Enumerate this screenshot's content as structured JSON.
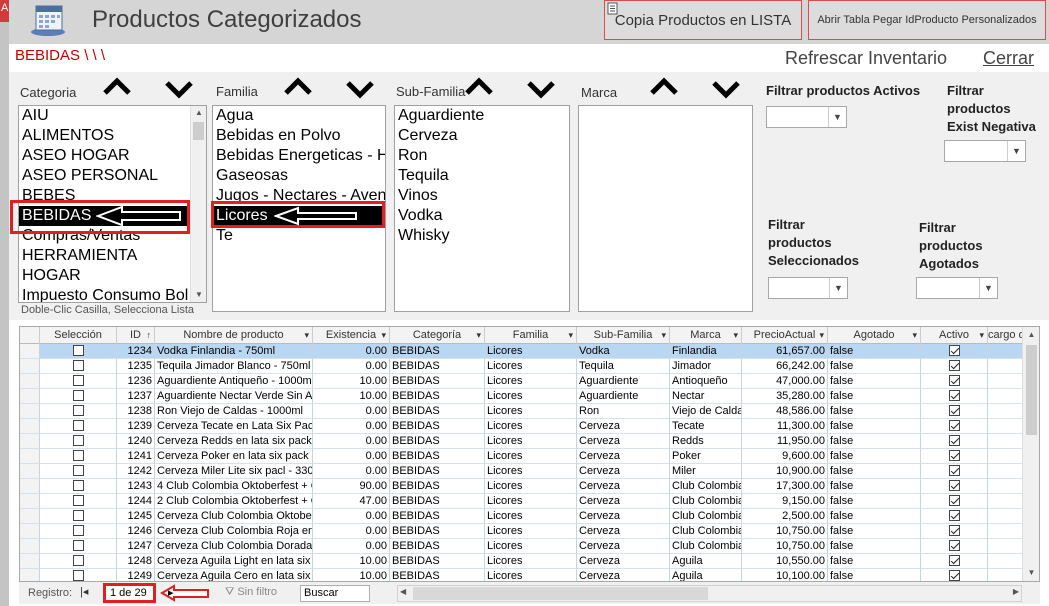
{
  "window": {
    "title": "Productos Categorizados",
    "edge_letter": "A"
  },
  "toolbar": {
    "copy_list_label": "Copia Productos en LISTA",
    "open_table_label": "Abrir Tabla Pegar IdProducto Personalizados",
    "refresh_label": "Refrescar Inventario",
    "close_label": "Cerrar"
  },
  "breadcrumb": "BEBIDAS \\ \\ \\",
  "filters": {
    "categoria": {
      "label": "Categoria",
      "items": [
        "AIU",
        "ALIMENTOS",
        "ASEO HOGAR",
        "ASEO PERSONAL",
        "BEBES",
        "BEBIDAS",
        "Compras/Ventas",
        "HERRAMIENTA",
        "HOGAR",
        "Impuesto Consumo Bol"
      ],
      "selected": "BEBIDAS"
    },
    "familia": {
      "label": "Familia",
      "items": [
        "Agua",
        "Bebidas en Polvo",
        "Bebidas Energeticas - Hi",
        "Gaseosas",
        "Jugos - Nectares - Aven",
        "Licores",
        "Te"
      ],
      "selected": "Licores"
    },
    "subfamilia": {
      "label": "Sub-Familia",
      "items": [
        "Aguardiente",
        "Cerveza",
        "Ron",
        "Tequila",
        "Vinos",
        "Vodka",
        "Whisky"
      ]
    },
    "marca": {
      "label": "Marca",
      "items": []
    },
    "hint": "Doble-Clic Casilla, Selecciona Lista"
  },
  "side_filters": {
    "activos": "Filtrar productos Activos",
    "exist_negativa": "Filtrar productos Exist Negativa",
    "seleccionados": "Filtrar productos Seleccionados",
    "agotados": "Filtrar productos Agotados"
  },
  "table": {
    "columns": [
      "Selección",
      "ID",
      "Nombre de producto",
      "Existencia",
      "Categoría",
      "Familia",
      "Sub-Familia",
      "Marca",
      "PrecioActual",
      "Agotado",
      "Activo",
      "cargo de"
    ],
    "rows": [
      [
        "1234",
        "Vodka Finlandia - 750ml",
        "0.00",
        "BEBIDAS",
        "Licores",
        "Vodka",
        "Finlandia",
        "61,657.00",
        "false"
      ],
      [
        "1235",
        "Tequila Jimador Blanco - 750ml",
        "0.00",
        "BEBIDAS",
        "Licores",
        "Tequila",
        "Jimador",
        "66,242.00",
        "false"
      ],
      [
        "1236",
        "Aguardiente Antiqueño - 1000ml",
        "10.00",
        "BEBIDAS",
        "Licores",
        "Aguardiente",
        "Antioqueño",
        "47,000.00",
        "false"
      ],
      [
        "1237",
        "Aguardiente Nectar Verde Sin Az",
        "10.00",
        "BEBIDAS",
        "Licores",
        "Aguardiente",
        "Nectar",
        "35,280.00",
        "false"
      ],
      [
        "1238",
        "Ron Viejo de Caldas - 1000ml",
        "0.00",
        "BEBIDAS",
        "Licores",
        "Ron",
        "Viejo de Calda",
        "48,586.00",
        "false"
      ],
      [
        "1239",
        "Cerveza Tecate en Lata Six Pack",
        "0.00",
        "BEBIDAS",
        "Licores",
        "Cerveza",
        "Tecate",
        "11,300.00",
        "false"
      ],
      [
        "1240",
        "Cerveza Redds en lata six pack -",
        "0.00",
        "BEBIDAS",
        "Licores",
        "Cerveza",
        "Redds",
        "11,950.00",
        "false"
      ],
      [
        "1241",
        "Cerveza Poker en lata six pack -",
        "0.00",
        "BEBIDAS",
        "Licores",
        "Cerveza",
        "Poker",
        "9,600.00",
        "false"
      ],
      [
        "1242",
        "Cerveza Miler Lite six pacl - 330m",
        "0.00",
        "BEBIDAS",
        "Licores",
        "Cerveza",
        "Miler",
        "10,900.00",
        "false"
      ],
      [
        "1243",
        "4 Club Colombia Oktoberfest + Ch",
        "90.00",
        "BEBIDAS",
        "Licores",
        "Cerveza",
        "Club Colombia",
        "17,300.00",
        "false"
      ],
      [
        "1244",
        "2 Club Colombia Oktoberfest + Ch",
        "47.00",
        "BEBIDAS",
        "Licores",
        "Cerveza",
        "Club Colombia",
        "9,150.00",
        "false"
      ],
      [
        "1245",
        "Cerveza Club Colombia Oktoberfe",
        "0.00",
        "BEBIDAS",
        "Licores",
        "Cerveza",
        "Club Colombia",
        "2,500.00",
        "false"
      ],
      [
        "1246",
        "Cerveza Club Colombia Roja en la",
        "0.00",
        "BEBIDAS",
        "Licores",
        "Cerveza",
        "Club Colombia",
        "10,750.00",
        "false"
      ],
      [
        "1247",
        "Cerveza Club Colombia Dorada e",
        "0.00",
        "BEBIDAS",
        "Licores",
        "Cerveza",
        "Club Colombia",
        "10,750.00",
        "false"
      ],
      [
        "1248",
        "Cerveza Aguila Light en lata six p",
        "10.00",
        "BEBIDAS",
        "Licores",
        "Cerveza",
        "Aguila",
        "10,550.00",
        "false"
      ],
      [
        "1249",
        "Cerveza Aguila Cero en lata six p",
        "10.00",
        "BEBIDAS",
        "Licores",
        "Cerveza",
        "Aguila",
        "10,100.00",
        "false"
      ]
    ]
  },
  "nav": {
    "label": "Registro:",
    "counter": "1 de 29",
    "no_filter": "Sin filtro",
    "search": "Buscar"
  },
  "colors": {
    "accent_red": "#e02020",
    "selected_row": "#b9d6f2",
    "header_bg": "#d5d5d5"
  }
}
